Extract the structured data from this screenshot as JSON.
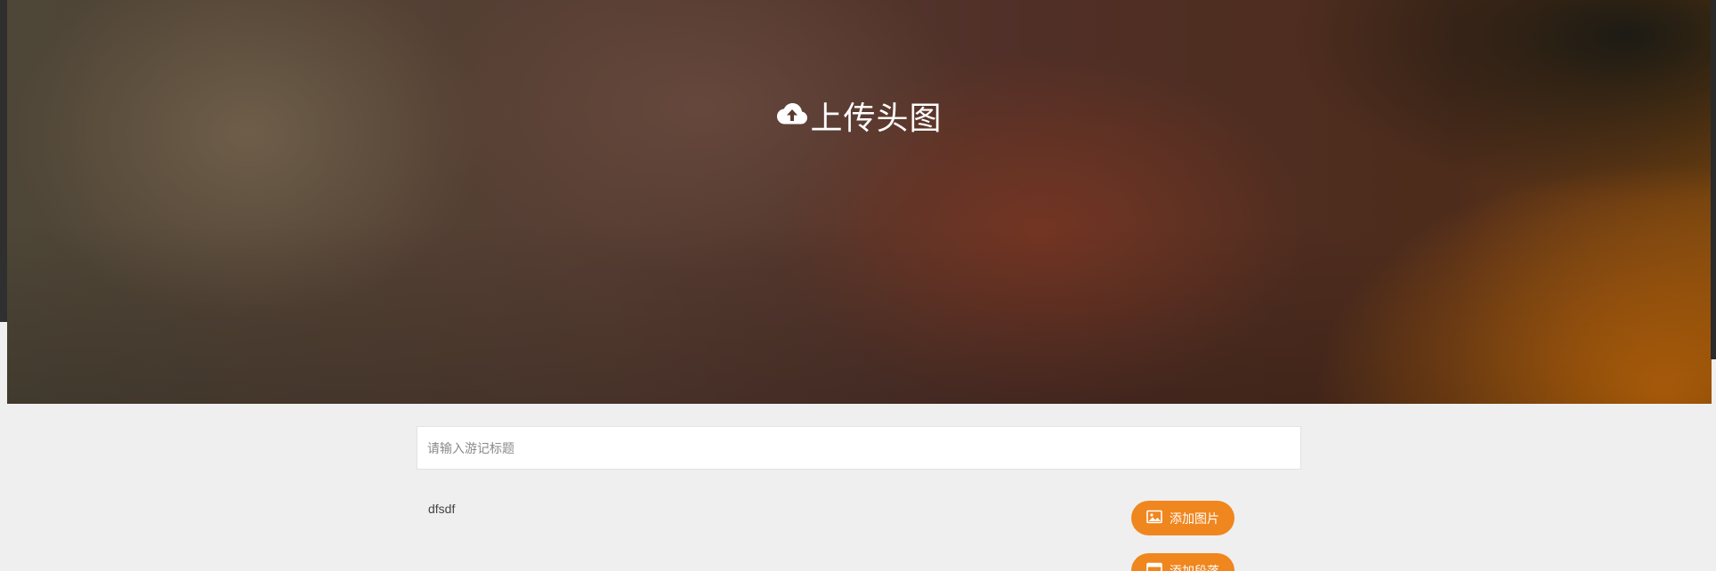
{
  "header": {
    "upload_cover_label": "上传头图",
    "upload_icon": "cloud-upload-icon"
  },
  "editor": {
    "title_placeholder": "请输入游记标题",
    "title_value": "",
    "content_text": "dfsdf"
  },
  "toolbar": {
    "add_image_label": "添加图片",
    "add_image_icon": "image-icon",
    "add_paragraph_label": "添加段落",
    "add_paragraph_icon": "paragraph-icon"
  },
  "colors": {
    "accent": "#f0861e",
    "page_bg": "#efefef"
  }
}
